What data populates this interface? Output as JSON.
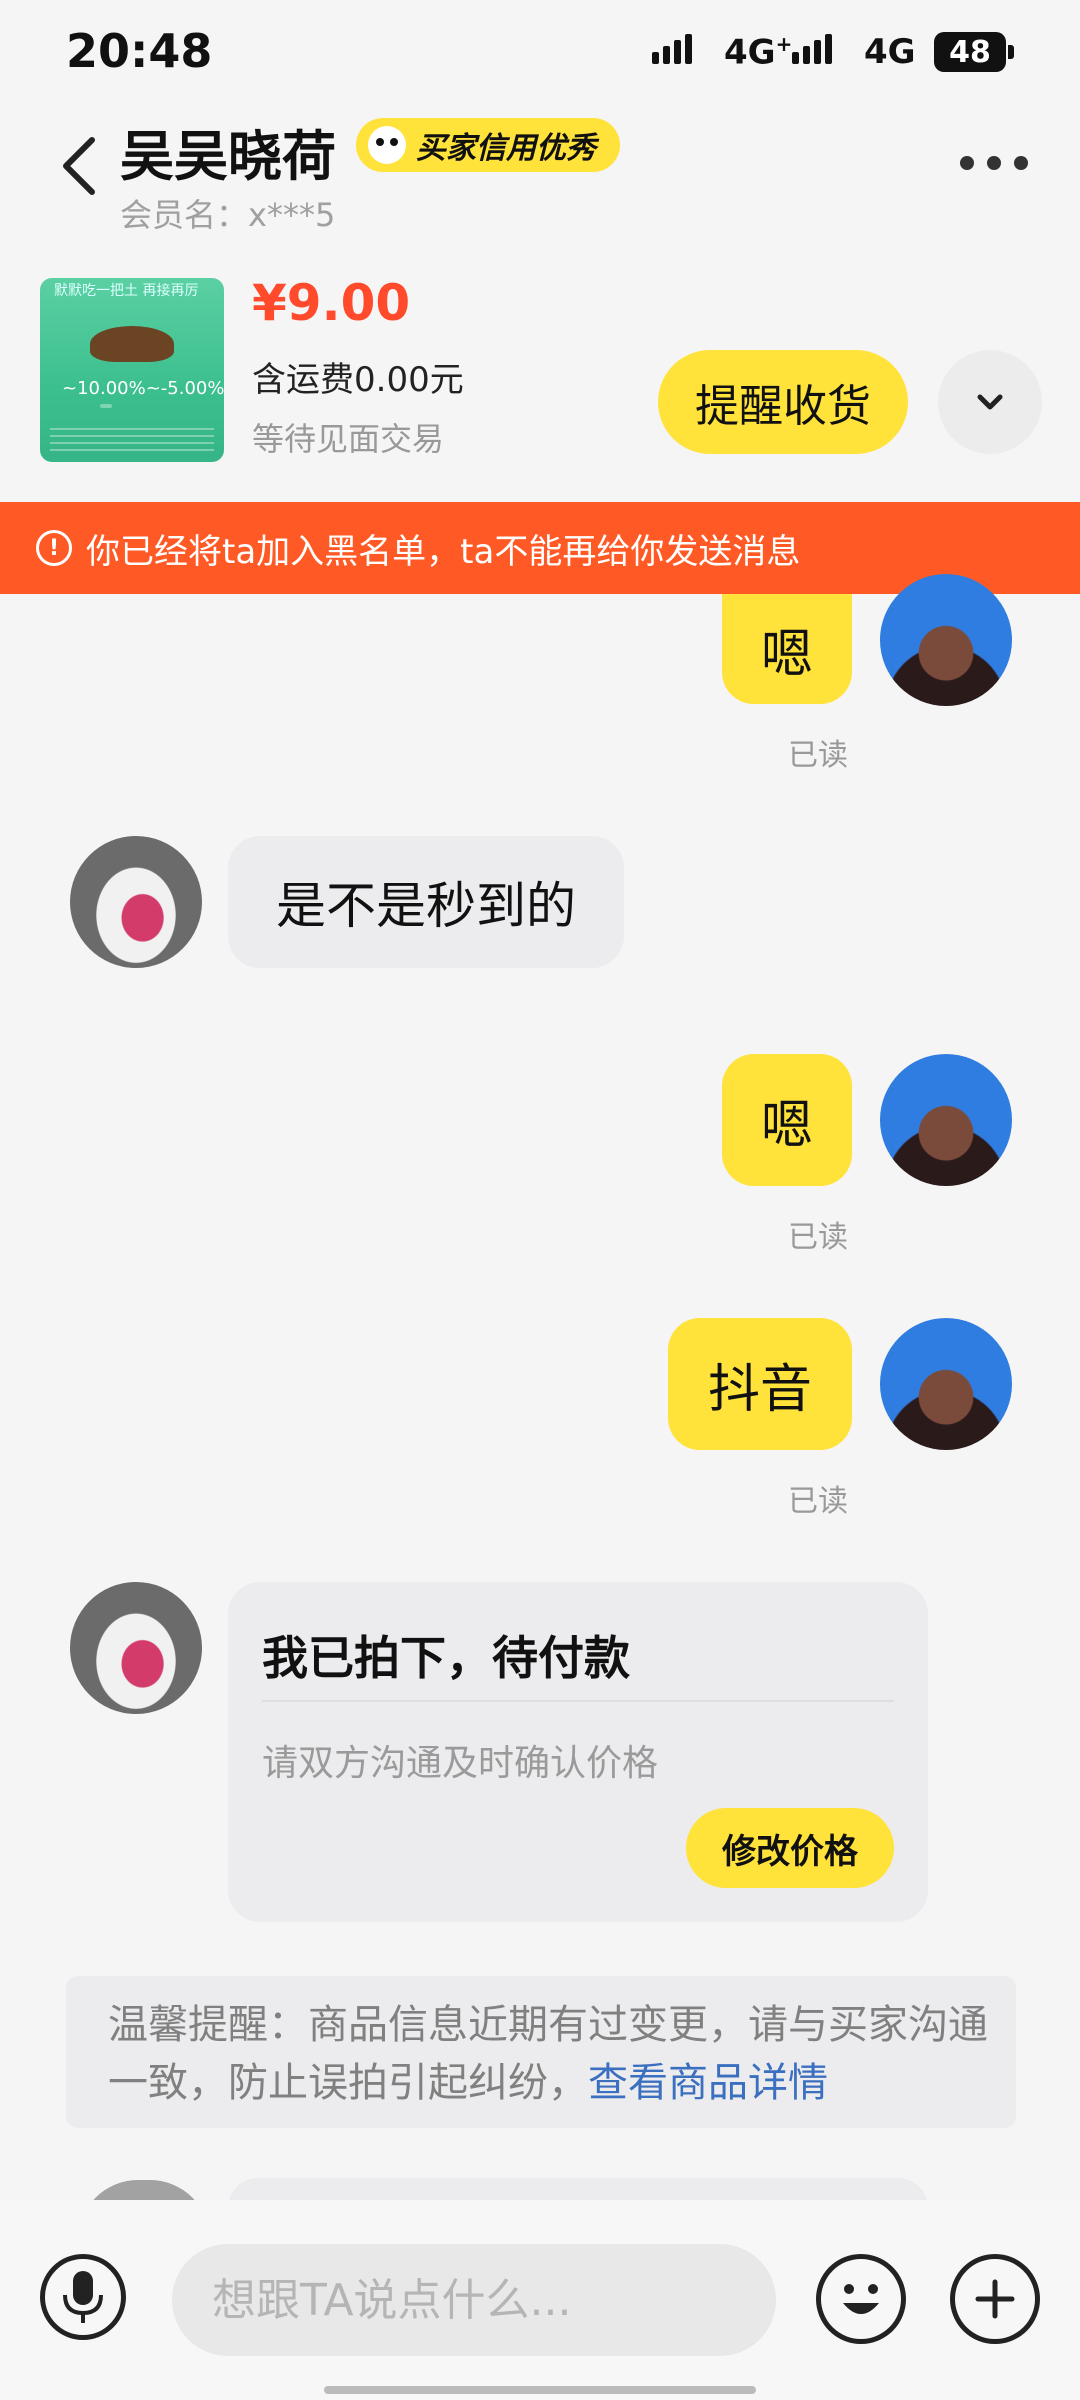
{
  "status_bar": {
    "time": "20:48",
    "network_1": "4G",
    "network_1_sup": "+",
    "network_2": "4G",
    "battery": "48"
  },
  "header": {
    "title": "吴吴晓荷",
    "credit_badge": "买家信用优秀",
    "member_label": "会员名：x***5"
  },
  "product": {
    "price": "¥9.00",
    "shipping": "含运费0.00元",
    "trade_status": "等待见面交易",
    "remind_button": "提醒收货",
    "image_percent": "~10.00%~-5.00%",
    "image_top_text": "默默吃一把土 再接再厉"
  },
  "banner": {
    "text": "你已经将ta加入黑名单，ta不能再给你发送消息",
    "icon": "alert-circle-icon"
  },
  "messages": [
    {
      "side": "me",
      "text": "嗯",
      "read": "已读"
    },
    {
      "side": "other",
      "text": "是不是秒到的"
    },
    {
      "side": "me",
      "text": "嗯",
      "read": "已读"
    },
    {
      "side": "me",
      "text": "抖音",
      "read": "已读"
    }
  ],
  "order_card": {
    "title": "我已拍下，待付款",
    "subtitle": "请双方沟通及时确认价格",
    "button": "修改价格"
  },
  "tip": {
    "text": "温馨提醒：商品信息近期有过变更，请与买家沟通一致，防止误拍引起纠纷，",
    "link": "查看商品详情"
  },
  "input": {
    "placeholder": "想跟TA说点什么..."
  },
  "colors": {
    "accent_yellow": "#ffe23a",
    "warning_orange": "#ff5a25",
    "price_red": "#ff4b2b",
    "link_blue": "#3b6fbf"
  }
}
